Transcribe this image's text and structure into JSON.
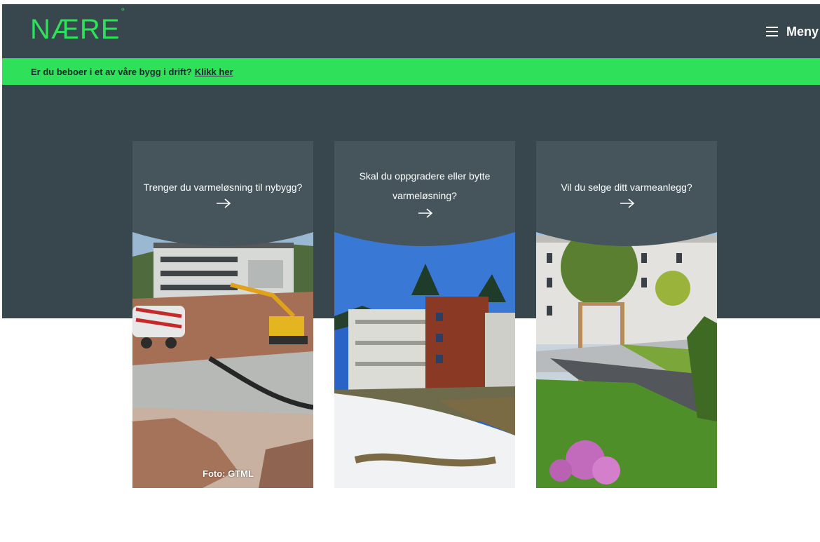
{
  "brand": {
    "logo_text": "NÆRE",
    "logo_mark": "°",
    "accent": "#2fe05a",
    "dark": "#37474d"
  },
  "header": {
    "menu_label": "Meny",
    "menu_icon": "hamburger-icon"
  },
  "banner": {
    "text": "Er du beboer i et av våre bygg i drift?",
    "link_text": "Klikk her"
  },
  "cards": [
    {
      "title": "Trenger du varmeløsning til nybygg?",
      "arrow": "arrow-right-icon",
      "caption": "Foto: GTML"
    },
    {
      "title": "Skal du oppgradere eller bytte varmeløsning?",
      "arrow": "arrow-right-icon"
    },
    {
      "title": "Vil du selge ditt varmeanlegg?",
      "arrow": "arrow-right-icon"
    }
  ]
}
